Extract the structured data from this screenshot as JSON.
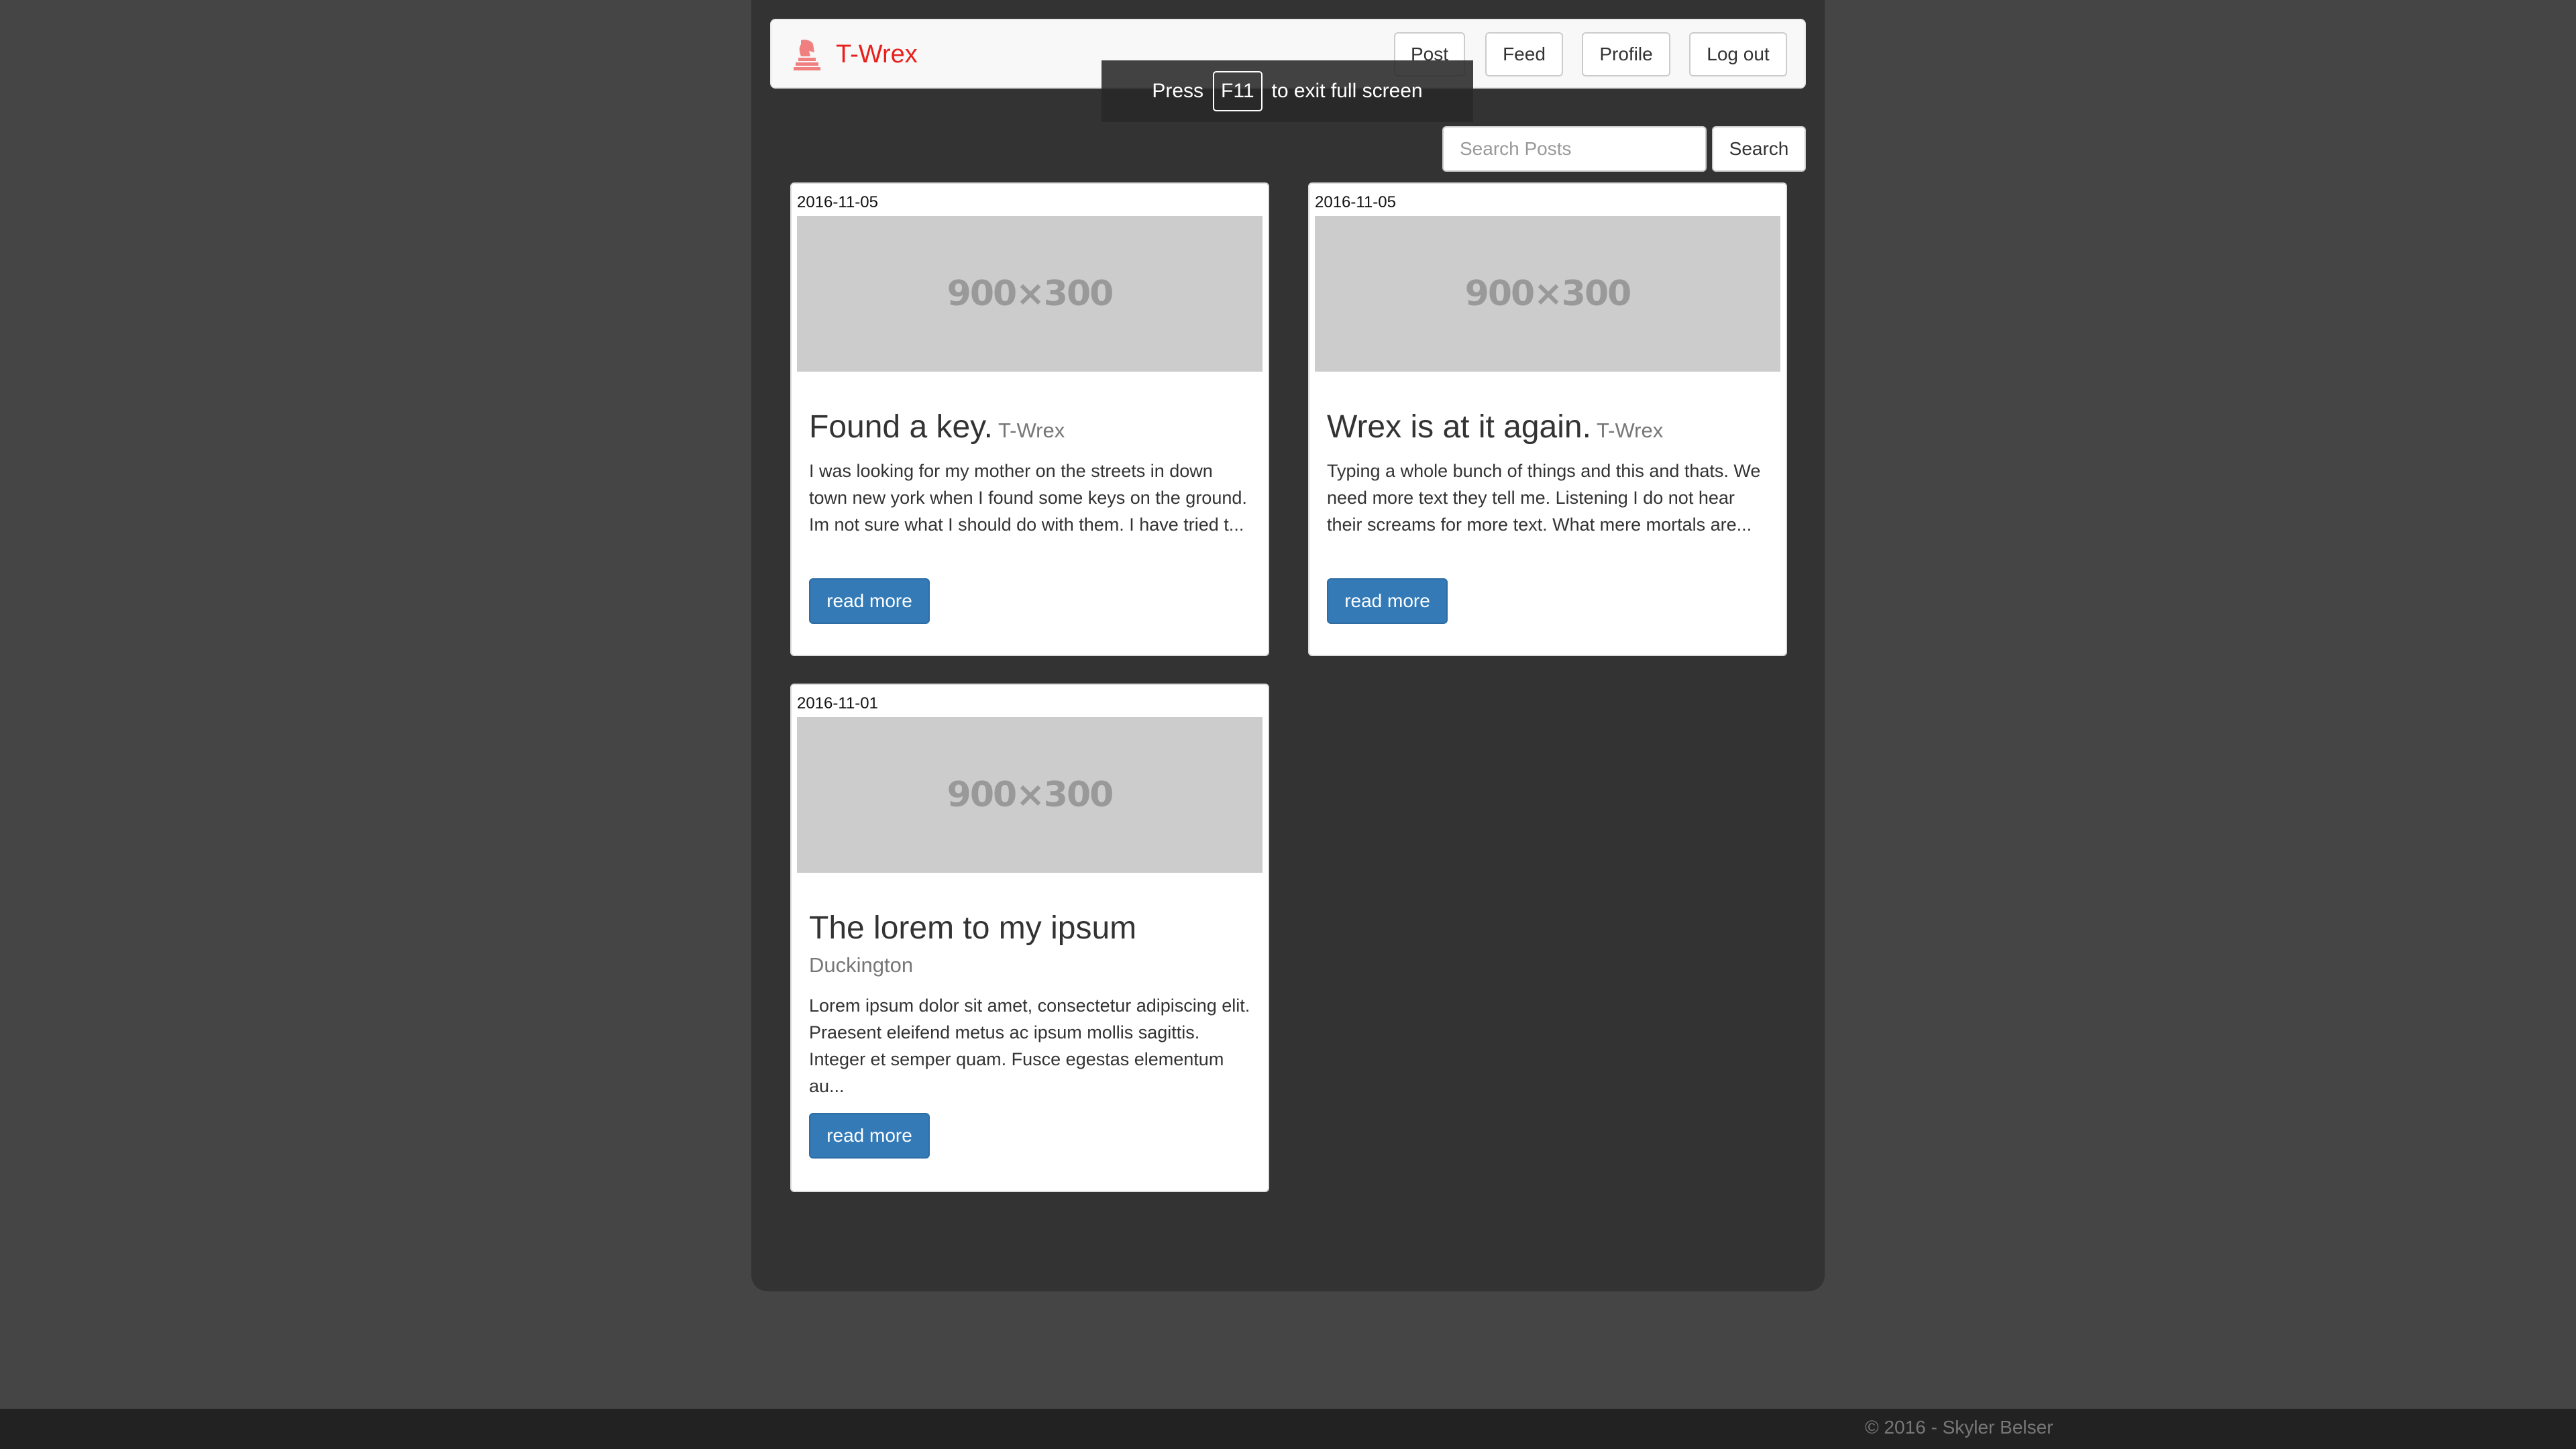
{
  "navbar": {
    "brand": "T-Wrex",
    "brand_icon": "chess-knight-icon",
    "brand_color": "#e8201b",
    "buttons": {
      "post": "Post",
      "feed": "Feed",
      "profile": "Profile",
      "logout": "Log out"
    }
  },
  "fullscreen_notice": {
    "prefix": "Press",
    "key": "F11",
    "suffix": "to exit full screen"
  },
  "search": {
    "placeholder": "Search Posts",
    "value": "",
    "button": "Search"
  },
  "posts": [
    {
      "date": "2016-11-05",
      "image_text": "900×300",
      "title": "Found a key.",
      "author": "T-Wrex",
      "excerpt": "I was looking for my mother on the streets in down town new york when I found some keys on the ground. Im not sure what I should do with them. I have tried t...",
      "button": "read more"
    },
    {
      "date": "2016-11-05",
      "image_text": "900×300",
      "title": "Wrex is at it again.",
      "author": "T-Wrex",
      "excerpt": "Typing a whole bunch of things and this and thats. We need more text they tell me. Listening I do not hear their screams for more text. What mere mortals are...",
      "button": "read more"
    },
    {
      "date": "2016-11-01",
      "image_text": "900×300",
      "title": "The lorem to my ipsum",
      "author": "Duckington",
      "excerpt": "Lorem ipsum dolor sit amet, consectetur adipiscing elit. Praesent eleifend metus ac ipsum mollis sagittis. Integer et semper quam. Fusce egestas elementum au...",
      "button": "read more"
    }
  ],
  "footer": {
    "text": "© 2016 - Skyler Belser"
  },
  "colors": {
    "page_background": "#454545",
    "container_background": "#333333",
    "primary_button": "#337ab7"
  }
}
